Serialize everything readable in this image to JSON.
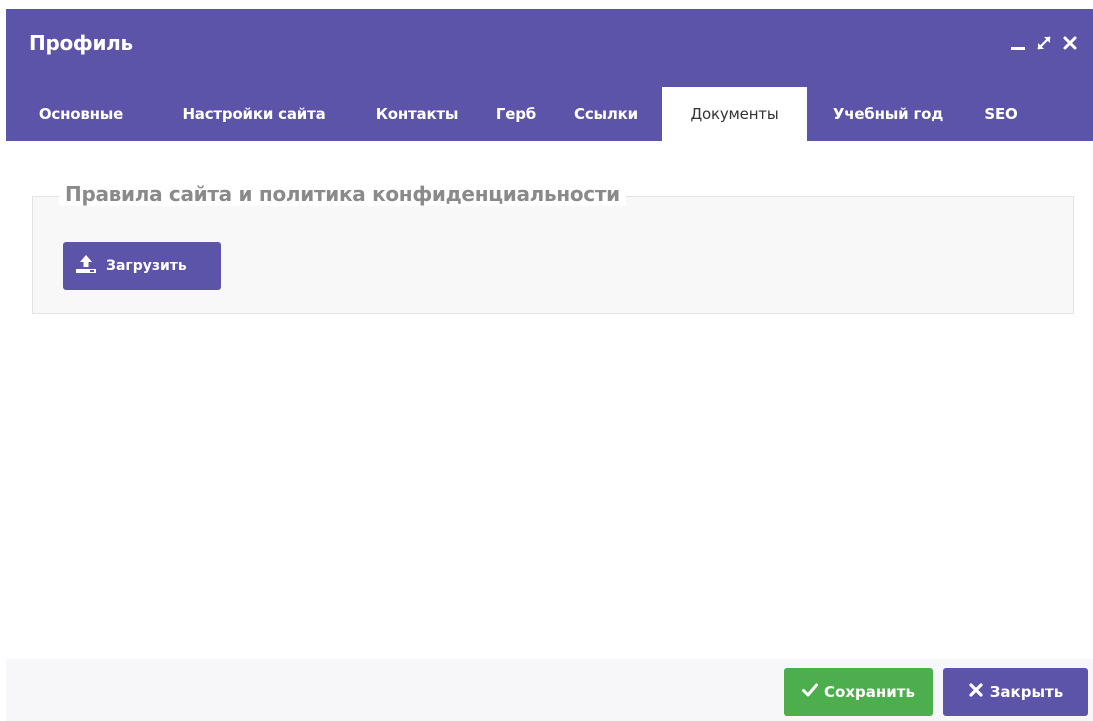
{
  "window": {
    "title": "Профиль",
    "controls": [
      "minimize-icon",
      "maximize-icon",
      "close-icon"
    ]
  },
  "tabs": [
    {
      "label": "Основные",
      "active": false
    },
    {
      "label": "Настройки сайта",
      "active": false
    },
    {
      "label": "Контакты",
      "active": false
    },
    {
      "label": "Герб",
      "active": false
    },
    {
      "label": "Ссылки",
      "active": false
    },
    {
      "label": "Документы",
      "active": true
    },
    {
      "label": "Учебный год",
      "active": false
    },
    {
      "label": "SEO",
      "active": false
    }
  ],
  "section": {
    "legend": "Правила сайта и политика конфиденциальности",
    "upload_label": "Загрузить",
    "upload_icon": "upload-icon"
  },
  "footer": {
    "save_label": "Сохранить",
    "save_icon": "check-icon",
    "close_label": "Закрыть",
    "close_icon": "close-icon"
  },
  "colors": {
    "primary": "#5b54a8",
    "success": "#4cae4c",
    "legend_text": "#8a8a8a"
  }
}
